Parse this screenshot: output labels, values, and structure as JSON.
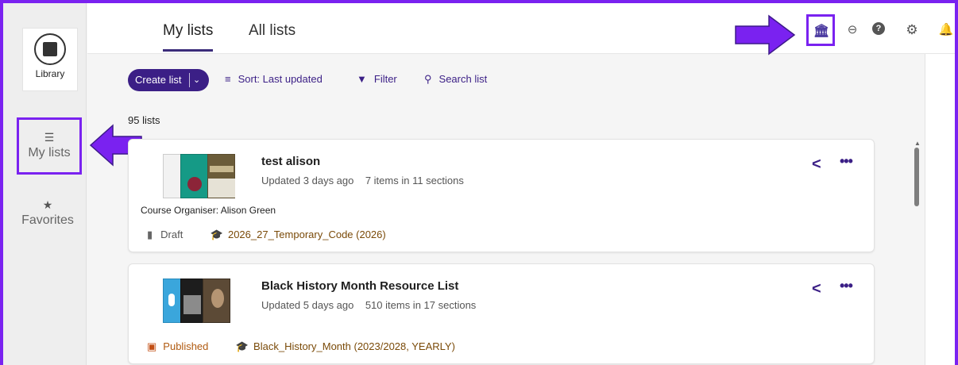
{
  "left_rail": {
    "logo": {
      "text": "Library"
    },
    "items": [
      {
        "label": "My lists",
        "icon": "list-icon"
      },
      {
        "label": "Favorites",
        "icon": "star-icon"
      }
    ]
  },
  "tabs": [
    {
      "label": "My lists",
      "active": true
    },
    {
      "label": "All lists",
      "active": false
    }
  ],
  "header_icons": [
    "institution-icon",
    "link-icon",
    "help-icon",
    "settings-icon",
    "notifications-icon"
  ],
  "toolbar": {
    "create_label": "Create list",
    "sort_label": "Sort: Last updated",
    "filter_label": "Filter",
    "search_label": "Search list"
  },
  "lists_count": "95 lists",
  "cards": [
    {
      "title": "test alison",
      "updated": "Updated 3 days ago",
      "items": "7 items in 11 sections",
      "organiser": "Course Organiser: Alison Green",
      "status": "Draft",
      "course": "2026_27_Temporary_Code (2026)"
    },
    {
      "title": "Black History Month Resource List",
      "updated": "Updated 5 days ago",
      "items": "510 items in 17 sections",
      "status": "Published",
      "course": "Black_History_Month (2023/2028, YEARLY)"
    }
  ],
  "colors": {
    "annotation": "#7a22f0",
    "primary": "#3b1f86",
    "course_brown": "#7a4a08",
    "published_orange": "#c24f15"
  }
}
